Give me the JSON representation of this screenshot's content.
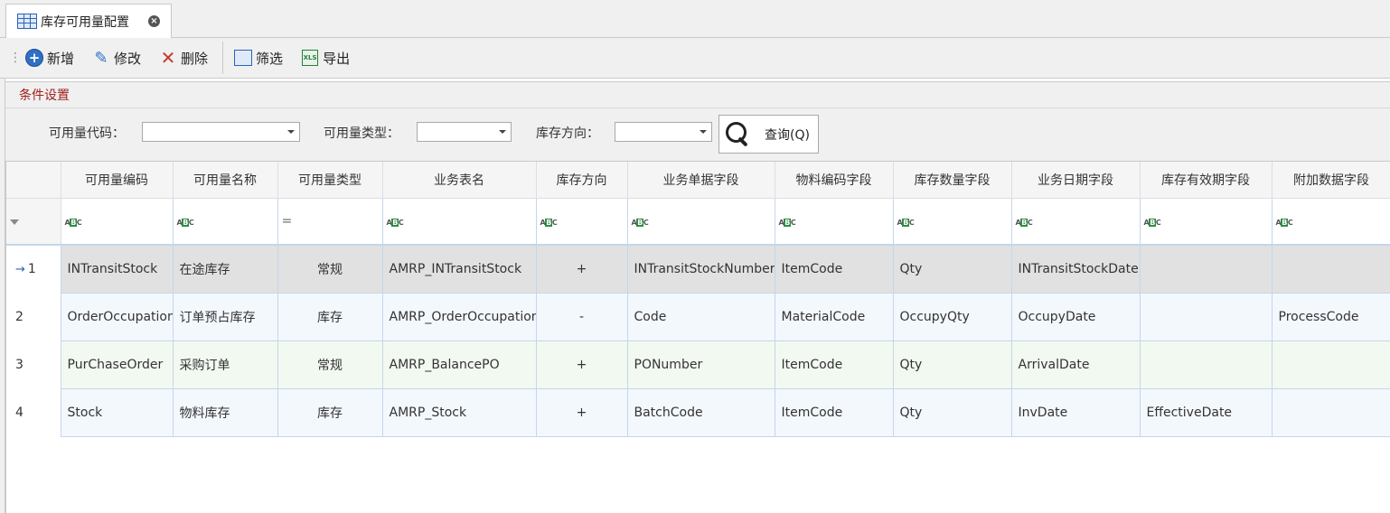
{
  "tab": {
    "title": "库存可用量配置"
  },
  "toolbar": {
    "add_label": "新增",
    "edit_label": "修改",
    "delete_label": "删除",
    "filter_label": "筛选",
    "export_label": "导出"
  },
  "conditions": {
    "title": "条件设置",
    "code_label": "可用量代码：",
    "code_value": "",
    "type_label": "可用量类型：",
    "type_value": "",
    "direction_label": "库存方向：",
    "direction_value": "",
    "query_label": "查询(Q)"
  },
  "grid": {
    "columns": [
      "可用量编码",
      "可用量名称",
      "可用量类型",
      "业务表名",
      "库存方向",
      "业务单据字段",
      "物料编码字段",
      "库存数量字段",
      "业务日期字段",
      "库存有效期字段",
      "附加数据字段"
    ],
    "rows": [
      {
        "num": "1",
        "code": "INTransitStock",
        "name": "在途库存",
        "type": "常规",
        "table": "AMRP_INTransitStock",
        "direction": "+",
        "doc_field": "INTransitStockNumber",
        "item_field": "ItemCode",
        "qty_field": "Qty",
        "date_field": "INTransitStockDate",
        "expiry_field": "",
        "extra_field": ""
      },
      {
        "num": "2",
        "code": "OrderOccupation",
        "name": "订单预占库存",
        "type": "库存",
        "table": "AMRP_OrderOccupation",
        "direction": "-",
        "doc_field": "Code",
        "item_field": "MaterialCode",
        "qty_field": "OccupyQty",
        "date_field": "OccupyDate",
        "expiry_field": "",
        "extra_field": "ProcessCode"
      },
      {
        "num": "3",
        "code": "PurChaseOrder",
        "name": "采购订单",
        "type": "常规",
        "table": "AMRP_BalancePO",
        "direction": "+",
        "doc_field": "PONumber",
        "item_field": "ItemCode",
        "qty_field": "Qty",
        "date_field": "ArrivalDate",
        "expiry_field": "",
        "extra_field": ""
      },
      {
        "num": "4",
        "code": "Stock",
        "name": "物料库存",
        "type": "库存",
        "table": "AMRP_Stock",
        "direction": "+",
        "doc_field": "BatchCode",
        "item_field": "ItemCode",
        "qty_field": "Qty",
        "date_field": "InvDate",
        "expiry_field": "EffectiveDate",
        "extra_field": ""
      }
    ]
  }
}
